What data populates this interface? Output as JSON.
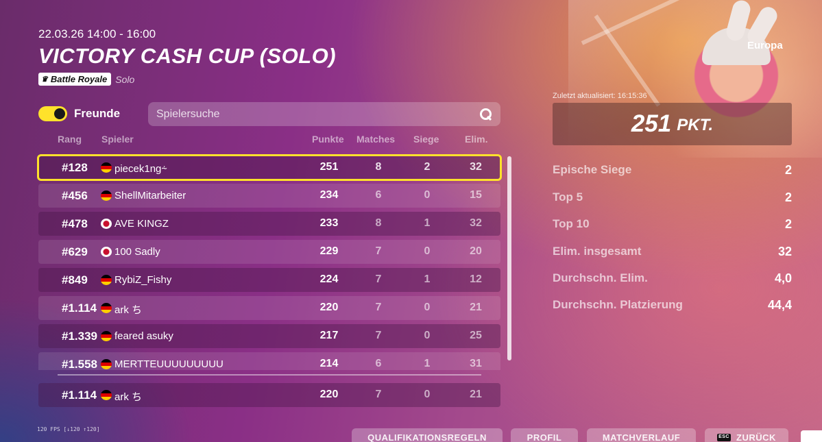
{
  "event": {
    "date": "22.03.26 14:00 - 16:00",
    "title": "VICTORY CASH CUP (SOLO)",
    "mode_badge": "Battle Royale",
    "mode_sub": "Solo",
    "mode_icon": "crown-icon"
  },
  "friends_toggle": {
    "label": "Freunde",
    "on": true
  },
  "search": {
    "placeholder": "Spielersuche",
    "icon": "search-icon"
  },
  "table": {
    "headers": {
      "rank": "Rang",
      "player": "Spieler",
      "points": "Punkte",
      "matches": "Matches",
      "wins": "Siege",
      "elims": "Elim."
    },
    "rows": [
      {
        "rank": "#128",
        "flag": "de",
        "name": "piecek1ng⸞",
        "points": "251",
        "matches": "8",
        "wins": "2",
        "elims": "32"
      },
      {
        "rank": "#456",
        "flag": "de",
        "name": "ShellMitarbeiter",
        "points": "234",
        "matches": "6",
        "wins": "0",
        "elims": "15"
      },
      {
        "rank": "#478",
        "flag": "jp",
        "name": "AVE KINGZ",
        "points": "233",
        "matches": "8",
        "wins": "1",
        "elims": "32"
      },
      {
        "rank": "#629",
        "flag": "jp",
        "name": "100 Sadly",
        "points": "229",
        "matches": "7",
        "wins": "0",
        "elims": "20"
      },
      {
        "rank": "#849",
        "flag": "de",
        "name": "RybiZ_Fishy",
        "points": "224",
        "matches": "7",
        "wins": "1",
        "elims": "12"
      },
      {
        "rank": "#1.114",
        "flag": "de",
        "name": "ark ち",
        "points": "220",
        "matches": "7",
        "wins": "0",
        "elims": "21"
      },
      {
        "rank": "#1.339",
        "flag": "de",
        "name": "feared asuky",
        "points": "217",
        "matches": "7",
        "wins": "0",
        "elims": "25"
      },
      {
        "rank": "#1.558",
        "flag": "de",
        "name": "MERTTEUUUUUUUUU",
        "points": "214",
        "matches": "6",
        "wins": "1",
        "elims": "31"
      }
    ],
    "pinned_row": {
      "rank": "#1.114",
      "flag": "de",
      "name": "ark ち",
      "points": "220",
      "matches": "7",
      "wins": "0",
      "elims": "21"
    }
  },
  "summary": {
    "region": "Europa",
    "updated": "Zuletzt aktualisiert: 16:15:36",
    "points_value": "251",
    "points_unit": "PKT.",
    "stats": [
      {
        "label": "Epische Siege",
        "value": "2"
      },
      {
        "label": "Top 5",
        "value": "2"
      },
      {
        "label": "Top 10",
        "value": "2"
      },
      {
        "label": "Elim. insgesamt",
        "value": "32"
      },
      {
        "label": "Durchschn. Elim.",
        "value": "4,0"
      },
      {
        "label": "Durchschn. Platzierung",
        "value": "44,4"
      }
    ]
  },
  "fps": "120 FPS [↓120 ↑120]",
  "buttons": {
    "rules": "QUALIFIKATIONSREGELN",
    "profile": "PROFIL",
    "history": "MATCHVERLAUF",
    "back": "ZURÜCK",
    "back_key": "ESC"
  },
  "colors": {
    "accent": "#ffe22b"
  }
}
